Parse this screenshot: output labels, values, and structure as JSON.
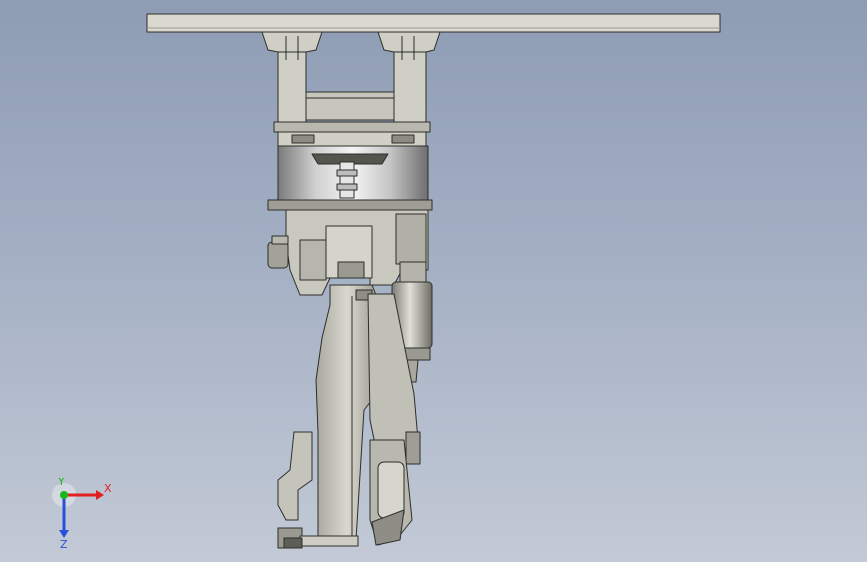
{
  "viewport": {
    "colors": {
      "bg_top": "#8e9cb4",
      "bg_bottom": "#c3cad6",
      "part_light": "#d6d6cc",
      "part_mid": "#b4b4aa",
      "part_dark": "#7c7c74",
      "edge": "#2e2e2a",
      "silver_light": "#ececec",
      "silver_dark": "#8a8a8a"
    }
  },
  "triad": {
    "x_label": "X",
    "y_label": "Y",
    "z_label": "Z",
    "x_color": "#e02020",
    "y_color": "#18b818",
    "z_color": "#2a4fd8"
  }
}
